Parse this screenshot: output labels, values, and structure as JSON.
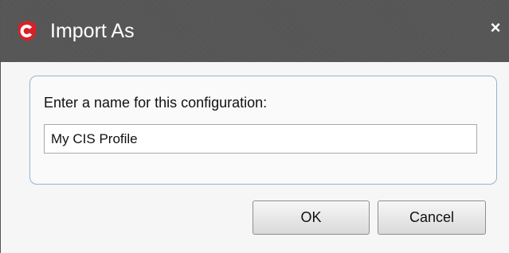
{
  "window": {
    "title": "Import As",
    "icon": "comodo-shield-icon",
    "close_glyph": "×"
  },
  "form": {
    "prompt": "Enter a name for this configuration:",
    "name_value": "My CIS Profile"
  },
  "buttons": {
    "ok_label": "OK",
    "cancel_label": "Cancel"
  },
  "colors": {
    "titlebar": "#565656",
    "icon_red": "#d92027",
    "group_border": "#8fb6d6"
  }
}
